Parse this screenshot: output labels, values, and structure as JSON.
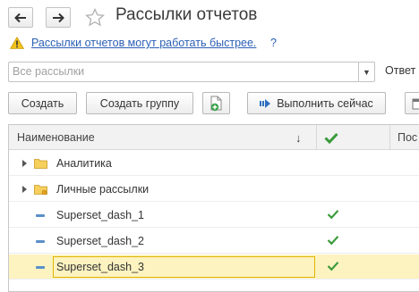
{
  "header": {
    "title": "Рассылки отчетов"
  },
  "hint": {
    "text": "Рассылки отчетов могут работать быстрее.",
    "help": "?"
  },
  "filter": {
    "placeholder": "Все рассылки",
    "right_label": "Ответ"
  },
  "toolbar": {
    "create": "Создать",
    "create_group": "Создать группу",
    "run_now": "Выполнить сейчас"
  },
  "table": {
    "columns": {
      "name": "Наименование",
      "sort_indicator": "↓",
      "last": "Пос"
    },
    "rows": [
      {
        "name": "Аналитика",
        "type": "group",
        "checked": false,
        "selected": false
      },
      {
        "name": "Личные рассылки",
        "type": "personal-group",
        "checked": false,
        "selected": false
      },
      {
        "name": "Superset_dash_1",
        "type": "item",
        "checked": true,
        "selected": false
      },
      {
        "name": "Superset_dash_2",
        "type": "item",
        "checked": true,
        "selected": false
      },
      {
        "name": "Superset_dash_3",
        "type": "item",
        "checked": true,
        "selected": true
      }
    ]
  },
  "colors": {
    "link": "#2b5fb4",
    "check": "#3a9a3a",
    "selection": "#fdf3c0",
    "edit_border": "#e0b400"
  }
}
